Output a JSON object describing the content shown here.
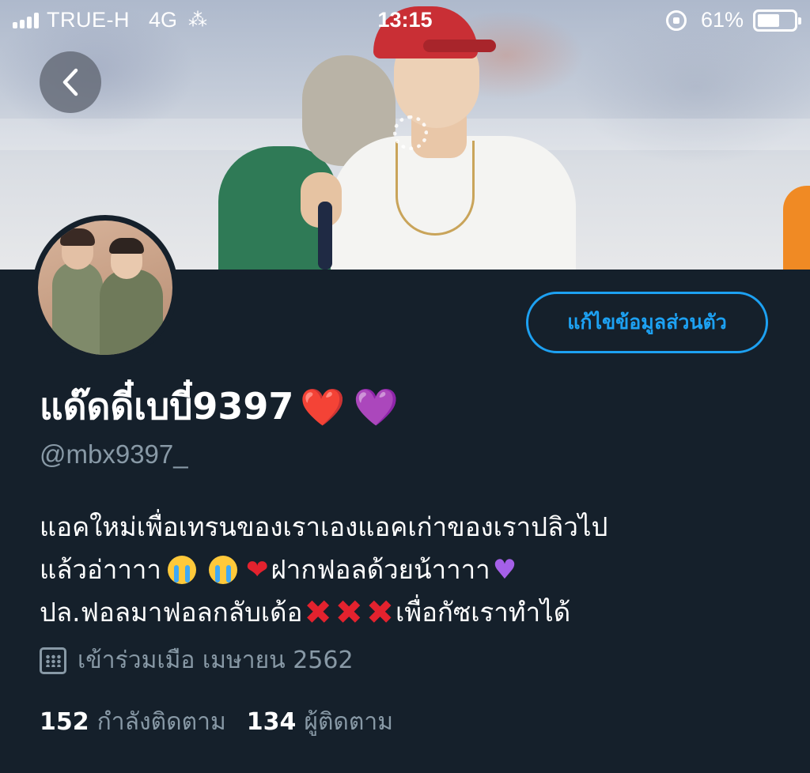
{
  "status_bar": {
    "carrier": "TRUE-H",
    "network": "4G",
    "time": "13:15",
    "battery_percent": "61%",
    "battery_level": 0.61
  },
  "profile": {
    "display_name": "แด๊ดดี๋เบบี๋9397",
    "name_emojis": [
      "❤️",
      "💜"
    ],
    "handle": "@mbx9397_",
    "edit_button_label": "แก้ไขข้อมูลส่วนตัว",
    "bio": {
      "line1": "แอคใหม่เพื่อเทรนของเราเองแอคเก่าของเราปลิวไป",
      "line2_a": "แล้วอ่าาาา",
      "line2_b": "ฝากฟอลด้วยน้าาาา",
      "line3_a": "ปล.ฟอลมาฟอลกลับเด้อ",
      "line3_b": "เพื่อกัซเราทำได้"
    },
    "joined": "เข้าร่วมเมือ เมษายน 2562",
    "following_count": "152",
    "following_label": "กำลังติดตาม",
    "followers_count": "134",
    "followers_label": "ผู้ติดตาม"
  },
  "colors": {
    "background": "#15202b",
    "accent": "#1da1f2",
    "muted_text": "#8899a6",
    "heart_red": "#e3222e",
    "heart_purple": "#a560e8"
  },
  "icons": {
    "back": "chevron-left-icon",
    "calendar": "calendar-icon",
    "loading": "spinner-icon"
  }
}
